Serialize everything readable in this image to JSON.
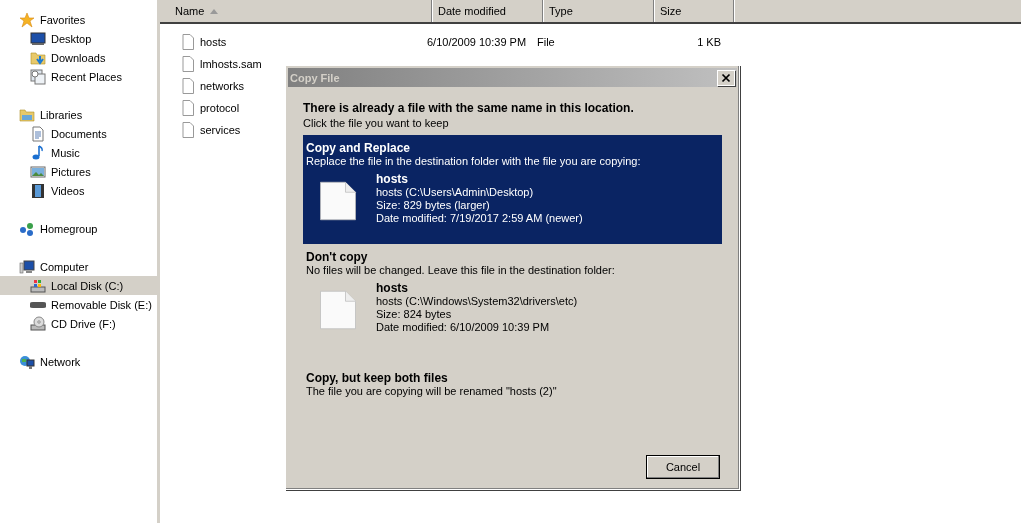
{
  "sidebar": {
    "groups": [
      {
        "label": "Favorites",
        "selected": false,
        "children": [
          {
            "label": "Desktop",
            "selected": false
          },
          {
            "label": "Downloads",
            "selected": false
          },
          {
            "label": "Recent Places",
            "selected": false
          }
        ]
      },
      {
        "label": "Libraries",
        "selected": false,
        "children": [
          {
            "label": "Documents",
            "selected": false
          },
          {
            "label": "Music",
            "selected": false
          },
          {
            "label": "Pictures",
            "selected": false
          },
          {
            "label": "Videos",
            "selected": false
          }
        ]
      },
      {
        "label": "Homegroup",
        "selected": false
      },
      {
        "label": "Computer",
        "selected": false,
        "children": [
          {
            "label": "Local Disk (C:)",
            "selected": true
          },
          {
            "label": "Removable Disk (E:)",
            "selected": false
          },
          {
            "label": "CD Drive (F:)",
            "selected": false
          }
        ]
      },
      {
        "label": "Network",
        "selected": false
      }
    ]
  },
  "file_list": {
    "columns": [
      {
        "label": "Name",
        "sorted": true
      },
      {
        "label": "Date modified",
        "sorted": false
      },
      {
        "label": "Type",
        "sorted": false
      },
      {
        "label": "Size",
        "sorted": false
      }
    ],
    "rows": [
      {
        "name": "hosts",
        "date": "6/10/2009 10:39 PM",
        "type": "File",
        "size": "1 KB"
      },
      {
        "name": "lmhosts.sam"
      },
      {
        "name": "networks"
      },
      {
        "name": "protocol"
      },
      {
        "name": "services"
      }
    ]
  },
  "dialog": {
    "title": "Copy File",
    "heading": "There is already a file with the same name in this location.",
    "instruction": "Click the file you want to keep",
    "options": [
      {
        "kind": "file",
        "selected": true,
        "title": "Copy and Replace",
        "description": "Replace the file in the destination folder with the file you are copying:",
        "file": {
          "name": "hosts",
          "lines": [
            "hosts (C:\\Users\\Admin\\Desktop)",
            "Size: 829 bytes (larger)",
            "Date modified: 7/19/2017 2:59 AM (newer)"
          ]
        }
      },
      {
        "kind": "file",
        "selected": false,
        "title": "Don't copy",
        "description": "No files will be changed. Leave this file in the destination folder:",
        "file": {
          "name": "hosts",
          "lines": [
            "hosts (C:\\Windows\\System32\\drivers\\etc)",
            "Size: 824 bytes",
            "Date modified: 6/10/2009 10:39 PM"
          ]
        }
      },
      {
        "kind": "plain",
        "selected": false,
        "title": "Copy, but keep both files",
        "description": "The file you are copying will be renamed \"hosts (2)\""
      }
    ],
    "buttons": [
      "Cancel"
    ]
  }
}
